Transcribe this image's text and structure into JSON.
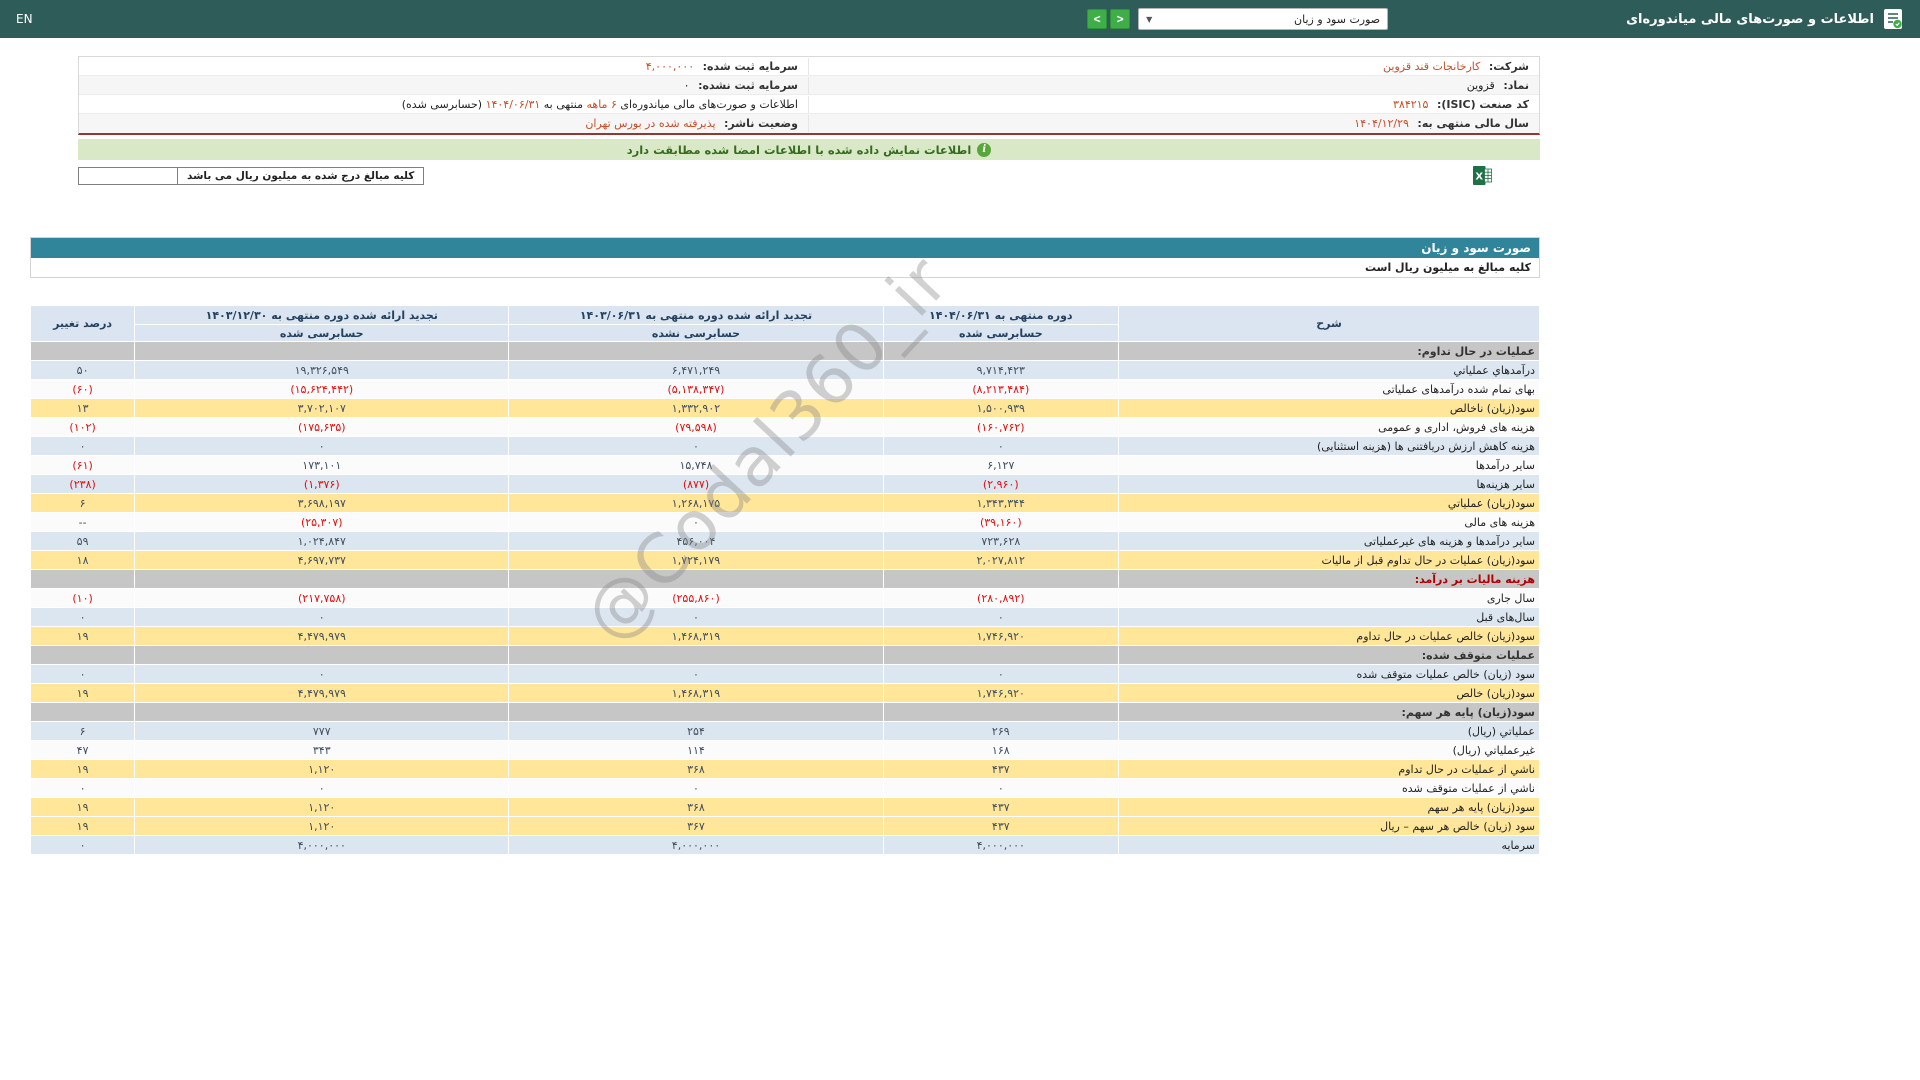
{
  "colors": {
    "topbar": "#2e5d59",
    "accent-green": "#3fae49",
    "teal-bar": "#31859b",
    "header-blue": "#dbe5f1",
    "row-blue": "#dce6f1",
    "row-yellow": "#ffe699",
    "row-section": "#c6c6c6",
    "negative-red": "#e01010",
    "info-red": "#c4502a",
    "number": "#3f4e5e"
  },
  "header": {
    "title": "اطلاعات و صورت‌های مالی میاندوره‌ای",
    "statement_select_value": "صورت سود و زیان",
    "select_caret": "▼",
    "nav_forward_label": ">",
    "nav_back_label": "<",
    "language_label": "EN"
  },
  "info": {
    "company_label": "شرکت:",
    "company_value": "کارخانجات قند قزوین",
    "symbol_label": "نماد:",
    "symbol_value": "قزوین",
    "isic_label": "کد صنعت (ISIC):",
    "isic_value": "۳۸۴۲۱۵",
    "fiscal_year_label": "سال مالی منتهی به:",
    "fiscal_year_value": "۱۴۰۴/۱۲/۲۹",
    "registered_capital_label": "سرمایه ثبت شده:",
    "registered_capital_value": "۴,۰۰۰,۰۰۰",
    "unregistered_capital_label": "سرمایه ثبت نشده:",
    "unregistered_capital_value": "۰",
    "period_text": "اطلاعات و صورت‌های مالی میاندوره‌ای",
    "period_length": "۶ ماهه",
    "period_middle": "منتهی به",
    "period_date": "۱۴۰۴/۰۶/۳۱",
    "period_suffix": "(حسابرسی شده)",
    "publisher_label": "وضعیت ناشر:",
    "publisher_value": "پذیرفته شده در بورس تهران"
  },
  "banner": {
    "text": "اطلاعات نمایش داده شده با اطلاعات امضا شده مطابقت دارد",
    "icon_glyph": "i"
  },
  "note_box": {
    "text": "کلیه مبالغ درج شده به میلیون ریال می باشد"
  },
  "watermark": "@Codal360_ir",
  "statement": {
    "title": "صورت سود و زیان",
    "amounts_note": "کلیه مبالغ به میلیون ریال است",
    "table": {
      "desc_header": "شرح",
      "pct_header": "درصد تغییر",
      "cols": [
        {
          "title": "دوره منتهی به ۱۴۰۴/۰۶/۳۱",
          "sub": "حسابرسی شده"
        },
        {
          "title": "تجدید ارائه شده دوره منتهی به ۱۴۰۳/۰۶/۳۱",
          "sub": "حسابرسی نشده"
        },
        {
          "title": "تجدید ارائه شده دوره منتهی به ۱۴۰۳/۱۲/۳۰",
          "sub": "حسابرسی شده"
        }
      ],
      "rows": [
        {
          "style": "section",
          "label": "عملیات در حال تداوم:"
        },
        {
          "style": "blue",
          "label": "درآمدهاي عملياتي",
          "values": [
            "۹,۷۱۴,۴۲۳",
            "۶,۴۷۱,۲۴۹",
            "۱۹,۳۲۶,۵۴۹"
          ],
          "pct": "۵۰"
        },
        {
          "style": "white",
          "label": "بهای تمام شده درآمدهای عملیاتی",
          "values": [
            "(۸,۲۱۳,۴۸۴)",
            "(۵,۱۳۸,۳۴۷)",
            "(۱۵,۶۲۴,۴۴۲)"
          ],
          "pct": "(۶۰)"
        },
        {
          "style": "yellow",
          "label": "سود(زیان) ناخالص",
          "values": [
            "۱,۵۰۰,۹۳۹",
            "۱,۳۳۲,۹۰۲",
            "۳,۷۰۲,۱۰۷"
          ],
          "pct": "۱۳"
        },
        {
          "style": "white",
          "label": "هزینه های فروش، اداری و عمومی",
          "values": [
            "(۱۶۰,۷۶۲)",
            "(۷۹,۵۹۸)",
            "(۱۷۵,۶۳۵)"
          ],
          "pct": "(۱۰۲)"
        },
        {
          "style": "blue",
          "label": "هزینه کاهش ارزش دریافتنی ها (هزینه استثنایی)",
          "values": [
            "۰",
            "۰",
            "۰"
          ],
          "pct": "۰"
        },
        {
          "style": "white",
          "label": "سایر درآمدها",
          "values": [
            "۶,۱۲۷",
            "۱۵,۷۴۸",
            "۱۷۳,۱۰۱"
          ],
          "pct": "(۶۱)"
        },
        {
          "style": "blue",
          "label": "سایر هزینه‌ها",
          "values": [
            "(۲,۹۶۰)",
            "(۸۷۷)",
            "(۱,۳۷۶)"
          ],
          "pct": "(۲۳۸)"
        },
        {
          "style": "yellow",
          "label": "سود(زیان) عملیاتي",
          "values": [
            "۱,۳۴۳,۳۴۴",
            "۱,۲۶۸,۱۷۵",
            "۳,۶۹۸,۱۹۷"
          ],
          "pct": "۶"
        },
        {
          "style": "white",
          "label": "هزینه های مالی",
          "values": [
            "(۳۹,۱۶۰)",
            "۰",
            "(۲۵,۳۰۷)"
          ],
          "pct": "--"
        },
        {
          "style": "blue",
          "label": "سایر درآمدها و هزینه های غیرعملیاتی",
          "values": [
            "۷۲۳,۶۲۸",
            "۴۵۶,۰۰۴",
            "۱,۰۲۴,۸۴۷"
          ],
          "pct": "۵۹"
        },
        {
          "style": "yellow",
          "label": "سود(زیان) عملیات در حال تداوم قبل از مالیات",
          "values": [
            "۲,۰۲۷,۸۱۲",
            "۱,۷۲۴,۱۷۹",
            "۴,۶۹۷,۷۳۷"
          ],
          "pct": "۱۸"
        },
        {
          "style": "section",
          "red": true,
          "label": "هزینه مالیات بر درآمد:"
        },
        {
          "style": "white",
          "label": "سال جاری",
          "values": [
            "(۲۸۰,۸۹۲)",
            "(۲۵۵,۸۶۰)",
            "(۲۱۷,۷۵۸)"
          ],
          "pct": "(۱۰)"
        },
        {
          "style": "blue",
          "label": "سال‌های قبل",
          "values": [
            "۰",
            "۰",
            "۰"
          ],
          "pct": "۰"
        },
        {
          "style": "yellow",
          "label": "سود(زیان) خالص عملیات در حال تداوم",
          "values": [
            "۱,۷۴۶,۹۲۰",
            "۱,۴۶۸,۳۱۹",
            "۴,۴۷۹,۹۷۹"
          ],
          "pct": "۱۹"
        },
        {
          "style": "section",
          "label": "عملیات متوقف شده:"
        },
        {
          "style": "blue",
          "label": "سود (زیان) خالص عملیات متوقف شده",
          "values": [
            "۰",
            "۰",
            "۰"
          ],
          "pct": "۰"
        },
        {
          "style": "yellow",
          "label": "سود(زیان) خالص",
          "values": [
            "۱,۷۴۶,۹۲۰",
            "۱,۴۶۸,۳۱۹",
            "۴,۴۷۹,۹۷۹"
          ],
          "pct": "۱۹"
        },
        {
          "style": "section",
          "label": "سود(زیان) پایه هر سهم:"
        },
        {
          "style": "blue",
          "label": "عملیاتي (ریال)",
          "values": [
            "۲۶۹",
            "۲۵۴",
            "۷۷۷"
          ],
          "pct": "۶"
        },
        {
          "style": "white",
          "label": "غیرعملیاتي (ریال)",
          "values": [
            "۱۶۸",
            "۱۱۴",
            "۳۴۳"
          ],
          "pct": "۴۷"
        },
        {
          "style": "yellow",
          "label": "ناشي از عملیات در حال تداوم",
          "values": [
            "۴۳۷",
            "۳۶۸",
            "۱,۱۲۰"
          ],
          "pct": "۱۹"
        },
        {
          "style": "white",
          "label": "ناشي از عملیات متوقف شده",
          "values": [
            "۰",
            "۰",
            "۰"
          ],
          "pct": "۰"
        },
        {
          "style": "yellow",
          "label": "سود(زیان) پایه هر سهم",
          "values": [
            "۴۳۷",
            "۳۶۸",
            "۱,۱۲۰"
          ],
          "pct": "۱۹"
        },
        {
          "style": "yellow",
          "label": "سود (زیان) خالص هر سهم – ریال",
          "values": [
            "۴۳۷",
            "۳۶۷",
            "۱,۱۲۰"
          ],
          "pct": "۱۹"
        },
        {
          "style": "blue",
          "label": "سرمایه",
          "values": [
            "۴,۰۰۰,۰۰۰",
            "۴,۰۰۰,۰۰۰",
            "۴,۰۰۰,۰۰۰"
          ],
          "pct": "۰"
        }
      ]
    }
  }
}
